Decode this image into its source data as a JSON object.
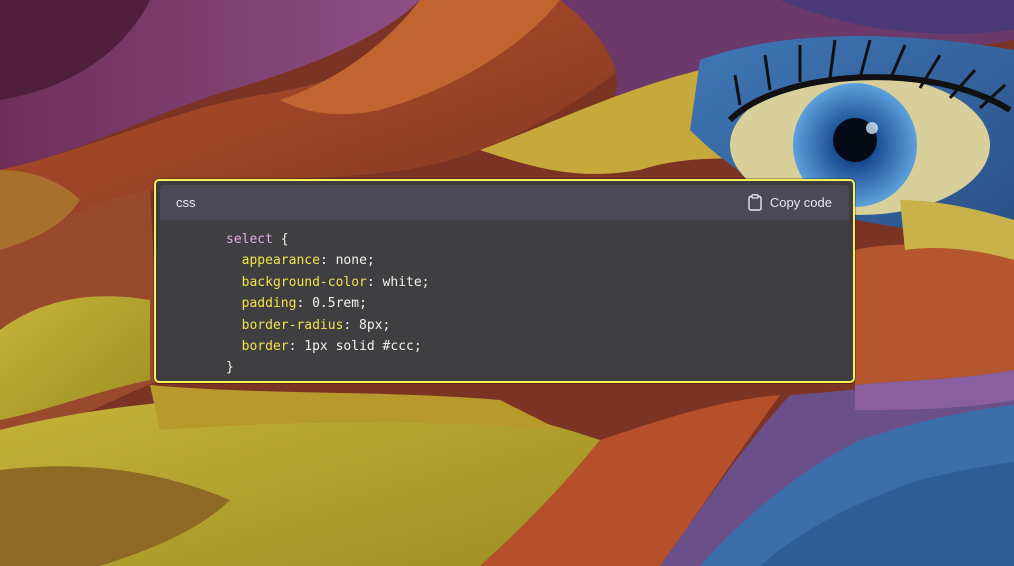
{
  "code_block": {
    "language": "css",
    "copy_label": "Copy code",
    "icons": {
      "copy": "clipboard-icon"
    },
    "colors": {
      "highlight_border": "#f4f05a",
      "header_bg": "#4b4957",
      "body_bg": "#3f3f41",
      "selector": "#e8a9e6",
      "property": "#f4e24a",
      "text": "#f2f2f2"
    },
    "lines": [
      {
        "indent": "",
        "selector": "select",
        "rest": " {"
      },
      {
        "indent": "  ",
        "property": "appearance",
        "rest": ": none;"
      },
      {
        "indent": "  ",
        "property": "background-color",
        "rest": ": white;"
      },
      {
        "indent": "  ",
        "property": "padding",
        "rest": ": 0.5rem;"
      },
      {
        "indent": "  ",
        "property": "border-radius",
        "rest": ": 8px;"
      },
      {
        "indent": "  ",
        "property": "border",
        "rest": ": 1px solid #ccc;"
      },
      {
        "indent": "",
        "rest": "}"
      }
    ]
  }
}
